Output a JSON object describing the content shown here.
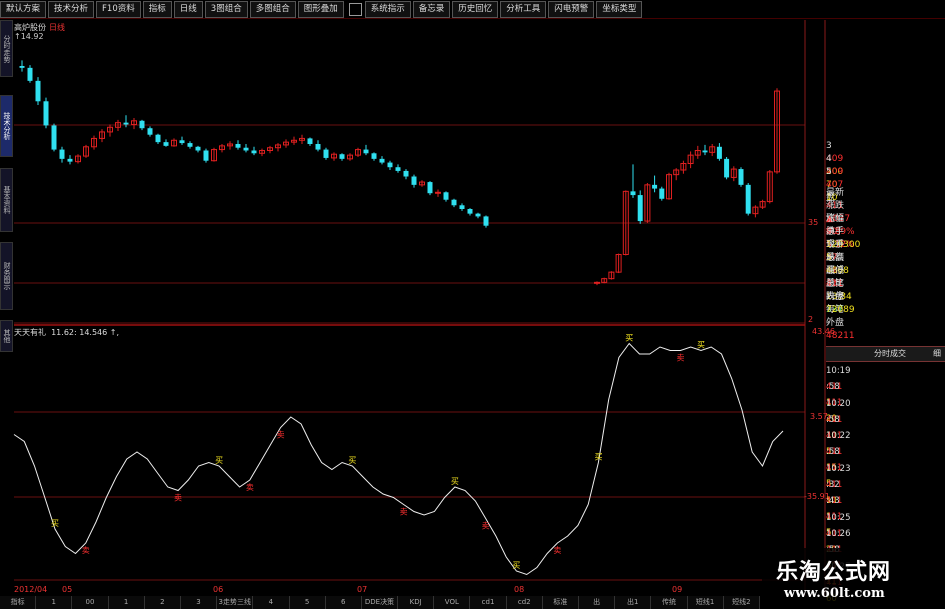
{
  "toolbar": {
    "items": [
      "默认方案",
      "技术分析",
      "F10资料",
      "指标",
      "日线",
      "3图组合",
      "多图组合",
      "图形叠加",
      "系统指示",
      "备忘录",
      "历史回忆",
      "分析工具",
      "闪电预警",
      "坐标类型"
    ]
  },
  "left_tabs": [
    "分时走势",
    "技术分析",
    "基本资料",
    "财务图示",
    "其他"
  ],
  "chart": {
    "stock_title": "高炉股份",
    "period": "日线",
    "high_marker": "14.92",
    "price_label_a": "35",
    "price_label_b": "2",
    "indicator_title": "天天有礼",
    "indicator_values": "11.62: 14.546 ↑,",
    "axis_top": "43.46",
    "axis_mid": "3.57",
    "axis_low": "-35.91",
    "time_labels": [
      "2012/04",
      "05",
      "06",
      "07",
      "08",
      "09"
    ],
    "mark_up": "买",
    "mark_down": "卖"
  },
  "quote": {
    "asks": [
      {
        "level": "3",
        "price": "409",
        "vol": "200"
      },
      {
        "level": "4",
        "price": "409",
        "vol": "70"
      },
      {
        "level": "5",
        "price": "407",
        "vol": "10"
      }
    ],
    "side_label": "盘",
    "rows": [
      {
        "l1": "最新",
        "v1": "411",
        "l2": "均价",
        "v2": "40"
      },
      {
        "l1": "涨跌",
        "v1": "▲037",
        "l2": "换手",
        "v2": "5.12%"
      },
      {
        "l1": "涨幅",
        "v1": "9.89%",
        "l2": "今开",
        "v2": "37"
      },
      {
        "l1": "总手",
        "v1": "120300",
        "l2": "最高",
        "v2": "41"
      },
      {
        "l1": "现手",
        "v1": "5",
        "l2": "最低",
        "v2": "37"
      },
      {
        "l1": "总额",
        "v1": "4868",
        "l2": "量比",
        "v2": "13.34"
      },
      {
        "l1": "涨停",
        "v1": "411",
        "l2": "跌停",
        "v2": "337"
      },
      {
        "l1": "总笔",
        "v1": "-",
        "l2": "每笔",
        "v2": "-"
      },
      {
        "l1": "内盘",
        "v1": "72089",
        "l2": "外盘",
        "v2": "48211"
      }
    ]
  },
  "ticks": {
    "header": "分时成交",
    "header_right": "细",
    "rows": [
      {
        "t": "10:19",
        "p": "411",
        "v": "1"
      },
      {
        "t": ":58",
        "p": "411",
        "v": "20"
      },
      {
        "t": "10:20",
        "p": "411",
        "v": "10"
      },
      {
        "t": ":58",
        "p": "411",
        "v": "5"
      },
      {
        "t": "10:22",
        "p": "411",
        "v": "15"
      },
      {
        "t": ":58",
        "p": "411",
        "v": "5"
      },
      {
        "t": "10:23",
        "p": "411",
        "v": "10"
      },
      {
        "t": ":32",
        "p": "411",
        "v": "1"
      },
      {
        "t": ":43",
        "p": "411",
        "v": "5"
      },
      {
        "t": "10:25",
        "p": "411",
        "v": "20"
      },
      {
        "t": "10:26",
        "p": "411",
        "v": "30"
      },
      {
        "t": ":58",
        "p": "411",
        "v": "11"
      },
      {
        "t": "10:27",
        "p": "411",
        "v": "60"
      }
    ]
  },
  "bottom_bar": [
    "指标",
    "1",
    "00",
    "1",
    "2",
    "3",
    "3走势三线",
    "4",
    "5",
    "6",
    "DDE决策",
    "KDJ",
    "VOL",
    "cd1",
    "cd2",
    "标准",
    "出",
    "出1",
    "传统",
    "短线1",
    "短线2"
  ],
  "watermark": {
    "cn": "乐淘公式网",
    "url": "www.60lt.com"
  },
  "colors": {
    "up": "#e02020",
    "down": "#30e0f0",
    "text_red": "#ff3030",
    "text_green": "#20e020",
    "text_yellow": "#f0e020",
    "grid": "#6a1010"
  },
  "candles": [
    [
      25.2,
      25.8,
      24.6,
      25.0
    ],
    [
      25.0,
      25.3,
      23.4,
      23.6
    ],
    [
      23.6,
      24.0,
      21.0,
      21.4
    ],
    [
      21.4,
      21.8,
      18.5,
      18.8
    ],
    [
      18.8,
      19.0,
      16.0,
      16.2
    ],
    [
      16.2,
      16.5,
      14.8,
      15.2
    ],
    [
      15.2,
      15.6,
      14.6,
      14.9
    ],
    [
      14.9,
      15.7,
      14.7,
      15.5
    ],
    [
      15.5,
      16.7,
      15.3,
      16.5
    ],
    [
      16.5,
      17.7,
      16.2,
      17.4
    ],
    [
      17.4,
      18.4,
      17.0,
      18.1
    ],
    [
      18.1,
      18.9,
      17.6,
      18.6
    ],
    [
      18.6,
      19.4,
      18.2,
      19.1
    ],
    [
      19.1,
      19.9,
      18.6,
      18.9
    ],
    [
      18.9,
      19.6,
      18.4,
      19.3
    ],
    [
      19.3,
      19.4,
      18.3,
      18.5
    ],
    [
      18.5,
      18.7,
      17.6,
      17.8
    ],
    [
      17.8,
      17.9,
      16.8,
      17.0
    ],
    [
      17.0,
      17.3,
      16.5,
      16.6
    ],
    [
      16.6,
      17.4,
      16.5,
      17.2
    ],
    [
      17.2,
      17.6,
      16.7,
      16.9
    ],
    [
      16.9,
      17.1,
      16.3,
      16.5
    ],
    [
      16.5,
      16.6,
      15.9,
      16.1
    ],
    [
      16.1,
      16.3,
      14.8,
      15.0
    ],
    [
      15.0,
      16.4,
      14.9,
      16.2
    ],
    [
      16.2,
      16.8,
      15.9,
      16.6
    ],
    [
      16.6,
      17.1,
      16.2,
      16.8
    ],
    [
      16.8,
      17.2,
      16.2,
      16.4
    ],
    [
      16.4,
      16.8,
      15.9,
      16.1
    ],
    [
      16.1,
      16.5,
      15.6,
      15.8
    ],
    [
      15.8,
      16.3,
      15.5,
      16.1
    ],
    [
      16.1,
      16.6,
      15.8,
      16.4
    ],
    [
      16.4,
      16.9,
      16.0,
      16.7
    ],
    [
      16.7,
      17.3,
      16.4,
      17.0
    ],
    [
      17.0,
      17.6,
      16.7,
      17.2
    ],
    [
      17.2,
      17.8,
      16.8,
      17.4
    ],
    [
      17.4,
      17.5,
      16.6,
      16.8
    ],
    [
      16.8,
      17.2,
      16.0,
      16.2
    ],
    [
      16.2,
      16.4,
      15.1,
      15.3
    ],
    [
      15.3,
      15.9,
      15.0,
      15.7
    ],
    [
      15.7,
      15.8,
      15.0,
      15.2
    ],
    [
      15.2,
      15.8,
      15.0,
      15.6
    ],
    [
      15.6,
      16.4,
      15.4,
      16.2
    ],
    [
      16.2,
      16.7,
      15.6,
      15.8
    ],
    [
      15.8,
      15.9,
      15.0,
      15.2
    ],
    [
      15.2,
      15.5,
      14.6,
      14.8
    ],
    [
      14.8,
      15.0,
      14.0,
      14.3
    ],
    [
      14.3,
      14.6,
      13.7,
      13.9
    ],
    [
      13.9,
      14.1,
      13.0,
      13.3
    ],
    [
      13.3,
      13.5,
      12.1,
      12.4
    ],
    [
      12.4,
      12.9,
      12.2,
      12.7
    ],
    [
      12.7,
      12.8,
      11.3,
      11.5
    ],
    [
      11.5,
      11.9,
      11.1,
      11.6
    ],
    [
      11.6,
      11.7,
      10.6,
      10.8
    ],
    [
      10.8,
      10.9,
      10.0,
      10.2
    ],
    [
      10.2,
      10.4,
      9.6,
      9.8
    ],
    [
      9.8,
      9.9,
      9.1,
      9.3
    ],
    [
      9.3,
      9.4,
      8.8,
      9.0
    ],
    [
      9.0,
      9.1,
      7.8,
      8.0
    ]
  ],
  "candles2": [
    [
      1.8,
      2.0,
      1.6,
      1.9
    ],
    [
      1.9,
      2.4,
      1.8,
      2.3
    ],
    [
      2.3,
      3.1,
      2.2,
      3.0
    ],
    [
      3.0,
      5.0,
      2.9,
      4.9
    ],
    [
      4.9,
      11.8,
      4.8,
      11.7
    ],
    [
      11.7,
      14.6,
      11.0,
      11.3
    ],
    [
      11.3,
      11.8,
      8.2,
      8.5
    ],
    [
      8.5,
      12.6,
      8.3,
      12.4
    ],
    [
      12.4,
      13.4,
      11.6,
      12.0
    ],
    [
      12.0,
      12.2,
      10.7,
      10.9
    ],
    [
      10.9,
      13.7,
      10.8,
      13.5
    ],
    [
      13.5,
      14.2,
      12.9,
      14.0
    ],
    [
      14.0,
      15.0,
      13.6,
      14.7
    ],
    [
      14.7,
      16.0,
      14.2,
      15.6
    ],
    [
      15.6,
      16.6,
      15.2,
      16.1
    ],
    [
      16.1,
      16.7,
      15.6,
      15.9
    ],
    [
      15.9,
      16.8,
      15.5,
      16.5
    ],
    [
      16.5,
      16.9,
      15.0,
      15.2
    ],
    [
      15.2,
      15.4,
      13.0,
      13.2
    ],
    [
      13.2,
      14.4,
      12.8,
      14.1
    ],
    [
      14.1,
      14.3,
      12.2,
      12.4
    ],
    [
      12.4,
      12.6,
      9.1,
      9.3
    ],
    [
      9.3,
      10.2,
      8.9,
      10.0
    ],
    [
      10.0,
      10.8,
      9.8,
      10.6
    ],
    [
      10.6,
      14.0,
      10.4,
      13.8
    ],
    [
      13.8,
      22.8,
      13.6,
      22.5
    ]
  ],
  "indicator_series": [
    -4,
    -8,
    -22,
    -40,
    -58,
    -68,
    -72,
    -66,
    -54,
    -40,
    -28,
    -18,
    -14,
    -18,
    -26,
    -34,
    -36,
    -30,
    -22,
    -20,
    -22,
    -28,
    -34,
    -30,
    -20,
    -10,
    0,
    6,
    2,
    -10,
    -20,
    -24,
    -20,
    -22,
    -28,
    -34,
    -38,
    -40,
    -44,
    -48,
    -50,
    -48,
    -40,
    -34,
    -36,
    -42,
    -52,
    -62,
    -74,
    -82,
    -84,
    -80,
    -72,
    -66,
    -62,
    -56,
    -44,
    -20,
    16,
    40,
    48,
    42,
    42,
    46,
    44,
    44,
    46,
    44,
    46,
    42,
    28,
    10,
    -14,
    -22,
    -8,
    -2
  ],
  "buy_idx": [
    4,
    20,
    33,
    43,
    49,
    57,
    60,
    67
  ],
  "sell_idx": [
    7,
    16,
    23,
    26,
    38,
    46,
    53,
    65
  ]
}
